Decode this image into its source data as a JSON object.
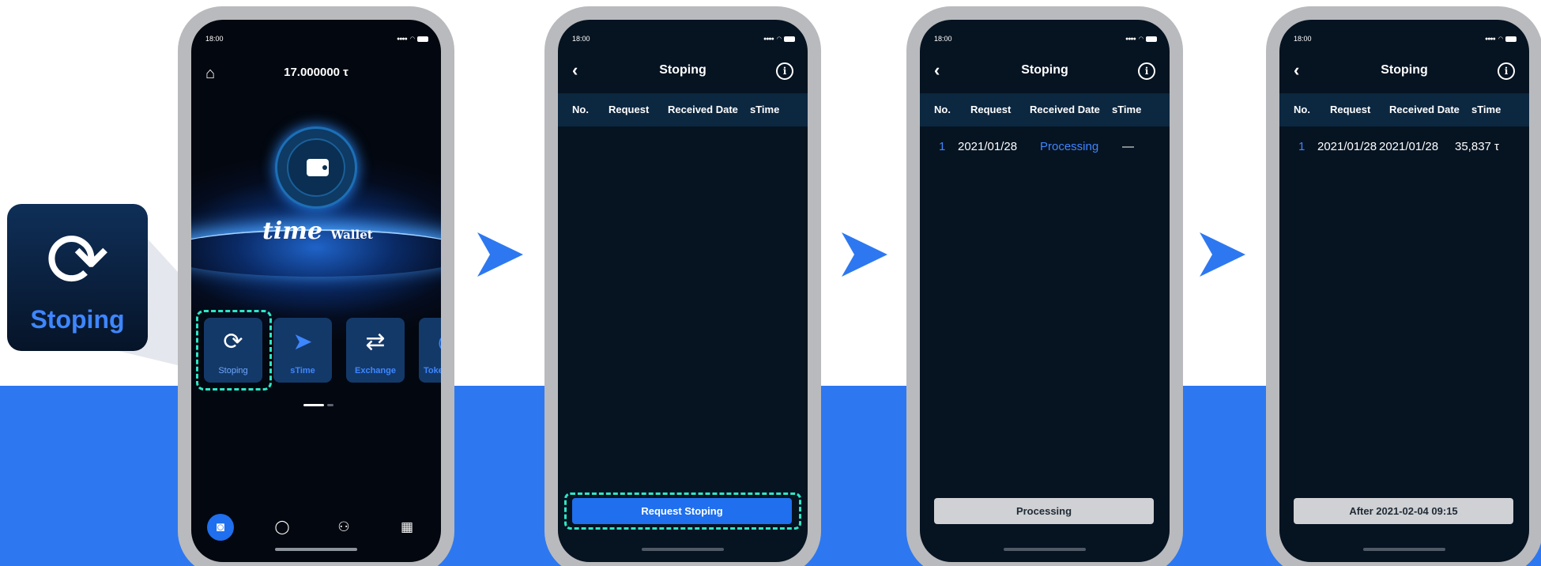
{
  "statusbar": {
    "time": "18:00"
  },
  "home": {
    "balance": "17.000000 τ",
    "logo_main": "time",
    "logo_sub": "Wallet",
    "tiles": [
      {
        "label": "Stoping",
        "glyph": "⟳",
        "icon": "refresh-icon"
      },
      {
        "label": "sTime",
        "glyph": "➤",
        "icon": "send-icon"
      },
      {
        "label": "Exchange",
        "glyph": "⇄",
        "icon": "exchange-icon"
      },
      {
        "label": "Toke",
        "glyph": "◎",
        "icon": "token-icon"
      }
    ],
    "tabbar": [
      "wallet-icon",
      "chat-icon",
      "community-icon",
      "calendar-icon"
    ]
  },
  "callout": {
    "label": "Stoping",
    "glyph": "⟳"
  },
  "stoping": {
    "title": "Stoping",
    "columns": [
      "No.",
      "Request",
      "Received Date",
      "sTime"
    ]
  },
  "screen2": {
    "button": "Request Stoping"
  },
  "screen3": {
    "row": {
      "no": "1",
      "request": "2021/01/28",
      "received": "Processing",
      "stime": "—"
    },
    "button": "Processing"
  },
  "screen4": {
    "row": {
      "no": "1",
      "request": "2021/01/28",
      "received": "2021/01/28",
      "stime": "35,837 τ"
    },
    "button": "After 2021-02-04 09:15"
  },
  "colors": {
    "accent": "#2d78f0",
    "highlight": "#2ee6c6",
    "screen_bg": "#061321"
  }
}
